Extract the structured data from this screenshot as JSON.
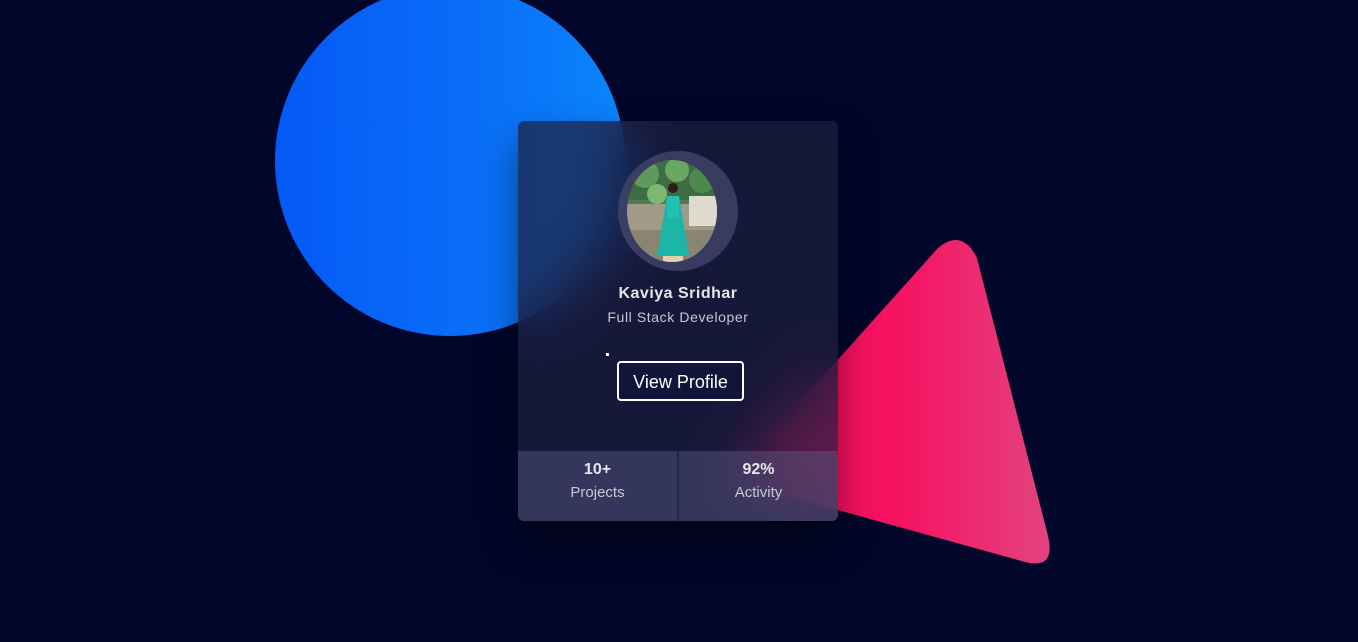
{
  "profile": {
    "name": "Kaviya Sridhar",
    "role": "Full Stack Developer",
    "button_label": "View Profile"
  },
  "stats": [
    {
      "value": "10+",
      "label": "Projects"
    },
    {
      "value": "92%",
      "label": "Activity"
    }
  ],
  "colors": {
    "background": "#02062a",
    "circle_blue": "#0a6df8",
    "triangle_pink": "#f5125f",
    "card": "#1e2040"
  },
  "icons": {
    "avatar": "profile-photo"
  }
}
